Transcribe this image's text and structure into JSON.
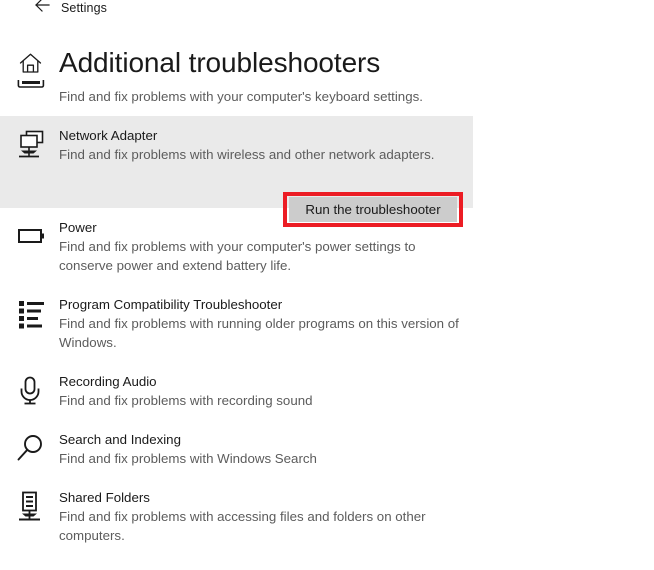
{
  "titlebar": {
    "back_label": "back-arrow",
    "title": "Settings"
  },
  "header": {
    "home_icon": "home-icon",
    "keyboard_icon": "keyboard-icon",
    "title": "Additional troubleshooters",
    "subtitle": "Find and fix problems with your computer's keyboard settings."
  },
  "colors": {
    "highlight": "#ec1c24",
    "selected_bg": "#eaeaea",
    "button_bg": "#cccccc",
    "text_primary": "#1a1a1a",
    "text_secondary": "#5c5c5c"
  },
  "troubleshooters": [
    {
      "icon": "network-adapter-icon",
      "name": "Network Adapter",
      "description": "Find and fix problems with wireless and other network adapters.",
      "selected": true,
      "action_label": "Run the troubleshooter"
    },
    {
      "icon": "battery-icon",
      "name": "Power",
      "description": "Find and fix problems with your computer's power settings to conserve power and extend battery life.",
      "selected": false
    },
    {
      "icon": "list-icon",
      "name": "Program Compatibility Troubleshooter",
      "description": "Find and fix problems with running older programs on this version of Windows.",
      "selected": false
    },
    {
      "icon": "microphone-icon",
      "name": "Recording Audio",
      "description": "Find and fix problems with recording sound",
      "selected": false
    },
    {
      "icon": "magnifier-icon",
      "name": "Search and Indexing",
      "description": "Find and fix problems with Windows Search",
      "selected": false
    },
    {
      "icon": "server-icon",
      "name": "Shared Folders",
      "description": "Find and fix problems with accessing files and folders on other computers.",
      "selected": false
    }
  ]
}
